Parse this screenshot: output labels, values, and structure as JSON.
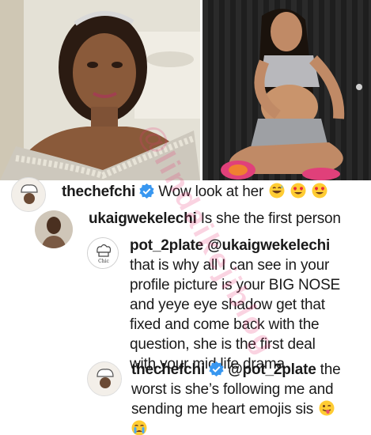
{
  "comments": [
    {
      "username": "thechefchi",
      "text": "Wow look at her",
      "emojis": [
        "grinning-sweat",
        "heart-eyes",
        "heart-eyes"
      ]
    },
    {
      "username": "ukaigwekelechi",
      "text": "Is she the first person"
    },
    {
      "username": "pot_2plate",
      "mention": "@ukaigwekelechi",
      "lines": [
        "that is why all I can see in your",
        "profile picture is your BIG NOSE",
        "and yeye eye shadow get that",
        "fixed and come back with the",
        "question, she is the first deal",
        "with your mid life drama"
      ]
    },
    {
      "username": "thechefchi",
      "mention": "@pot_2plate",
      "text_first": "the",
      "lines": [
        "worst is she’s following me and",
        "sending me heart emojis sis"
      ],
      "emojis": [
        "winking-tongue",
        "crying"
      ]
    }
  ],
  "watermark": "@lindaikejiblog",
  "colors": {
    "verified": "#3897f0",
    "watermark": "#e83878"
  }
}
